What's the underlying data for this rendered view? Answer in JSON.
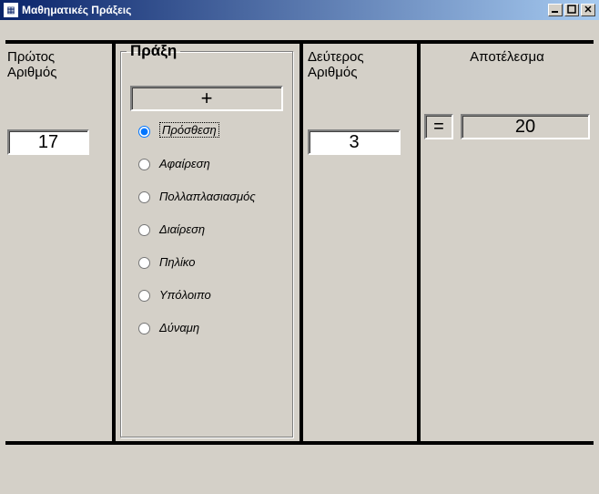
{
  "window": {
    "title": "Μαθηματικές Πράξεις"
  },
  "labels": {
    "first": "Πρώτος\nΑριθμός",
    "operation": "Πράξη",
    "second": "Δεύτερος\nΑριθμός",
    "result": "Αποτέλεσμα"
  },
  "values": {
    "first": "17",
    "opSymbol": "+",
    "second": "3",
    "equals": "=",
    "result": "20"
  },
  "operations": [
    {
      "label": "Πρόσθεση",
      "selected": true
    },
    {
      "label": "Αφαίρεση",
      "selected": false
    },
    {
      "label": "Πολλαπλασιασμός",
      "selected": false
    },
    {
      "label": "Διαίρεση",
      "selected": false
    },
    {
      "label": "Πηλίκο",
      "selected": false
    },
    {
      "label": "Υπόλοιπο",
      "selected": false
    },
    {
      "label": "Δύναμη",
      "selected": false
    }
  ]
}
